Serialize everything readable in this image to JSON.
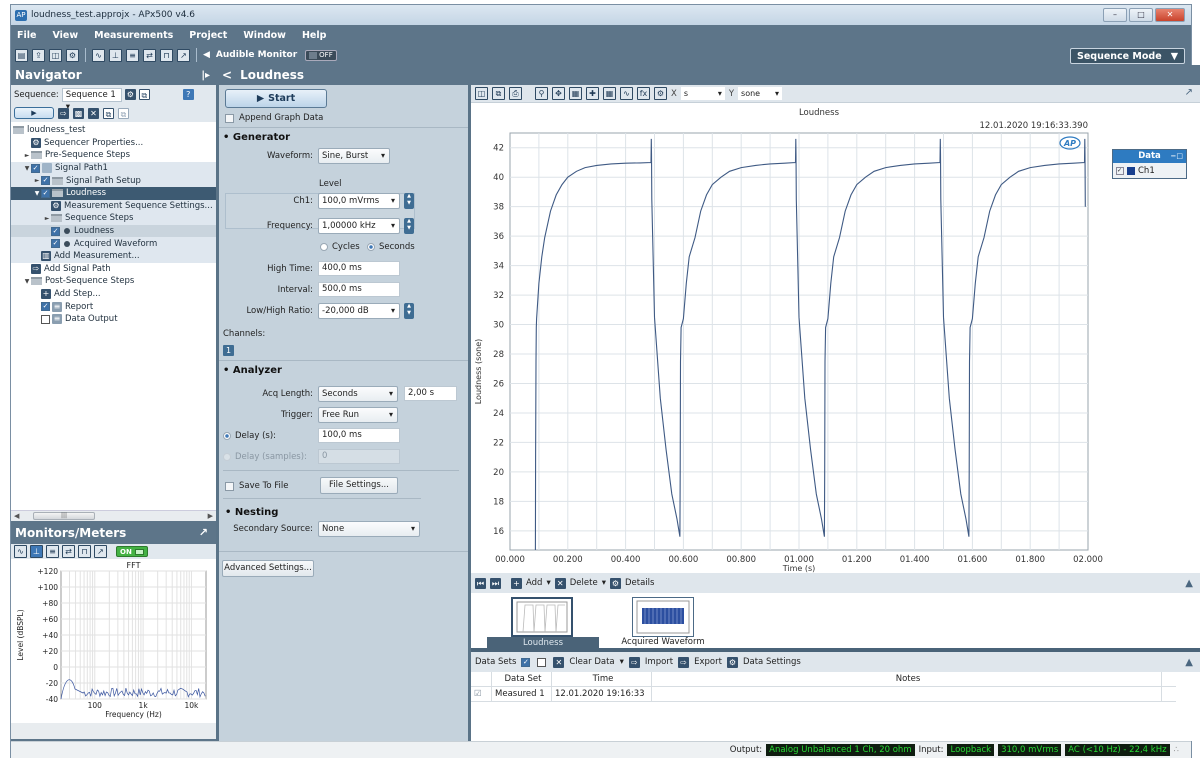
{
  "window": {
    "title": "loudness_test.approjx - APx500 v4.6",
    "buttons": [
      "minimize",
      "maximize",
      "close"
    ]
  },
  "menu": [
    "File",
    "View",
    "Measurements",
    "Project",
    "Window",
    "Help"
  ],
  "toolbar": {
    "icons": [
      "new-file-icon",
      "open-folder-icon",
      "save-icon",
      "settings-icon",
      "scope-icon",
      "fft-icon",
      "meter-icon",
      "level-icon",
      "pulse-icon",
      "add-monitor-icon"
    ],
    "audible_monitor_label": "Audible Monitor",
    "audible_monitor_state": "OFF",
    "mode_selector": "Sequence Mode"
  },
  "navigator": {
    "title": "Navigator",
    "sequence_label": "Sequence:",
    "sequence_value": "Sequence 1",
    "tree": [
      {
        "label": "loudness_test",
        "level": 0,
        "icon": "folder"
      },
      {
        "label": "Sequencer Properties...",
        "level": 1,
        "icon": "gear"
      },
      {
        "label": "Pre-Sequence Steps",
        "level": 1,
        "icon": "folder",
        "arrow": "►"
      },
      {
        "label": "Signal Path1",
        "level": 1,
        "icon": "signal-path",
        "arrow": "▼",
        "checked": true
      },
      {
        "label": "Signal Path Setup",
        "level": 2,
        "icon": "folder",
        "arrow": "►",
        "checked": true
      },
      {
        "label": "Loudness",
        "level": 2,
        "icon": "folder",
        "arrow": "▼",
        "checked": true,
        "selected": true
      },
      {
        "label": "Measurement Sequence Settings...",
        "level": 3,
        "icon": "gear"
      },
      {
        "label": "Sequence Steps",
        "level": 3,
        "icon": "folder",
        "arrow": "►"
      },
      {
        "label": "Loudness",
        "level": 3,
        "icon": "dot",
        "checked": true,
        "active": true
      },
      {
        "label": "Acquired Waveform",
        "level": 3,
        "icon": "dot",
        "checked": true
      },
      {
        "label": "Add Measurement...",
        "level": 2,
        "icon": "add-measurement"
      },
      {
        "label": "Add Signal Path",
        "level": 1,
        "icon": "add-signal-path"
      },
      {
        "label": "Post-Sequence Steps",
        "level": 1,
        "icon": "folder",
        "arrow": "▼"
      },
      {
        "label": "Add Step...",
        "level": 2,
        "icon": "plus"
      },
      {
        "label": "Report",
        "level": 2,
        "icon": "report",
        "checked": true
      },
      {
        "label": "Data Output",
        "level": 2,
        "icon": "data-output",
        "checked": false
      }
    ]
  },
  "monitors": {
    "title": "Monitors/Meters",
    "state": "ON",
    "fft": {
      "title": "FFT",
      "ylabel": "Level (dBSPL)",
      "xlabel": "Frequency (Hz)",
      "yticks": [
        "+120",
        "+100",
        "+80",
        "+60",
        "+40",
        "+20",
        "0",
        "-20",
        "-40"
      ],
      "xticks": [
        "100",
        "1k",
        "10k"
      ]
    }
  },
  "measurement": {
    "title": "Loudness",
    "start_label": "Start",
    "append_graph_data": "Append Graph Data",
    "generator": {
      "title": "Generator",
      "waveform_label": "Waveform:",
      "waveform": "Sine, Burst",
      "level_label": "Level",
      "ch1_label": "Ch1:",
      "ch1": "100,0 mVrms",
      "frequency_label": "Frequency:",
      "frequency": "1,00000 kHz",
      "cycles_label": "Cycles",
      "seconds_label": "Seconds",
      "high_time_label": "High Time:",
      "high_time": "400,0 ms",
      "interval_label": "Interval:",
      "interval": "500,0 ms",
      "ratio_label": "Low/High Ratio:",
      "ratio": "-20,000 dB",
      "channels_label": "Channels:",
      "channel_button": "1"
    },
    "analyzer": {
      "title": "Analyzer",
      "acq_length_label": "Acq Length:",
      "acq_length_mode": "Seconds",
      "acq_length": "2,00 s",
      "trigger_label": "Trigger:",
      "trigger": "Free Run",
      "delay_s_label": "Delay (s):",
      "delay_s": "100,0 ms",
      "delay_samples_label": "Delay (samples):",
      "delay_samples": "0",
      "save_to_file": "Save To File",
      "file_settings": "File Settings..."
    },
    "nesting": {
      "title": "Nesting",
      "secondary_source_label": "Secondary Source:",
      "secondary_source": "None"
    },
    "advanced_settings": "Advanced Settings..."
  },
  "graph": {
    "x_unit_label": "X",
    "x_unit": "s",
    "y_unit_label": "Y",
    "y_unit": "sone",
    "timestamp": "12.01.2020 19:16:33.390",
    "legend_title": "Data",
    "legend_items": [
      {
        "name": "Ch1",
        "color": "#173f8e",
        "checked": true
      }
    ]
  },
  "chart_data": {
    "type": "line",
    "title": "Loudness",
    "xlabel": "Time (s)",
    "ylabel": "Loudness (sone)",
    "xlim": [
      0,
      2.0
    ],
    "ylim": [
      14.7,
      43
    ],
    "xticks": [
      "00.000",
      "00.200",
      "00.400",
      "00.600",
      "00.800",
      "01.000",
      "01.200",
      "01.400",
      "01.600",
      "01.800",
      "02.000"
    ],
    "yticks": [
      16,
      18,
      20,
      22,
      24,
      26,
      28,
      30,
      32,
      34,
      36,
      38,
      40,
      42
    ],
    "grid": true,
    "legend": "right",
    "series": [
      {
        "name": "Ch1",
        "color": "#3f5a84",
        "x": [
          0.088,
          0.0885,
          0.09,
          0.091,
          0.092,
          0.1,
          0.11,
          0.12,
          0.14,
          0.16,
          0.18,
          0.2,
          0.23,
          0.26,
          0.3,
          0.35,
          0.4,
          0.45,
          0.488,
          0.489,
          0.4895,
          0.4905,
          0.5,
          0.52,
          0.54,
          0.56,
          0.578,
          0.588,
          0.589,
          0.59,
          0.592,
          0.6,
          0.61,
          0.62,
          0.64,
          0.66,
          0.68,
          0.7,
          0.73,
          0.76,
          0.8,
          0.85,
          0.9,
          0.95,
          0.988,
          0.989,
          0.9895,
          0.9905,
          1.0,
          1.02,
          1.04,
          1.06,
          1.078,
          1.088,
          1.089,
          1.09,
          1.092,
          1.1,
          1.11,
          1.12,
          1.14,
          1.16,
          1.18,
          1.2,
          1.23,
          1.26,
          1.3,
          1.35,
          1.4,
          1.45,
          1.488,
          1.489,
          1.4895,
          1.4905,
          1.5,
          1.52,
          1.54,
          1.56,
          1.578,
          1.588,
          1.589,
          1.59,
          1.592,
          1.6,
          1.61,
          1.62,
          1.64,
          1.66,
          1.68,
          1.7,
          1.73,
          1.76,
          1.8,
          1.85,
          1.9,
          1.95,
          1.988,
          1.989,
          1.9895,
          1.9905
        ],
        "y": [
          14.7,
          21.0,
          27.5,
          29.8,
          30.4,
          32.8,
          34.6,
          35.9,
          37.7,
          38.8,
          39.5,
          40.0,
          40.4,
          40.65,
          40.8,
          40.9,
          40.95,
          40.97,
          41.0,
          42.6,
          41.6,
          38.5,
          30.5,
          25.0,
          21.5,
          18.5,
          16.8,
          15.6,
          20.0,
          27.5,
          29.8,
          30.4,
          32.8,
          34.6,
          35.9,
          37.7,
          38.8,
          39.5,
          40.0,
          40.4,
          40.65,
          40.8,
          40.9,
          40.95,
          41.0,
          42.6,
          41.6,
          38.5,
          30.5,
          25.0,
          21.5,
          18.5,
          16.8,
          15.6,
          20.0,
          27.5,
          29.8,
          30.4,
          32.8,
          34.6,
          35.9,
          37.7,
          38.8,
          39.5,
          40.0,
          40.4,
          40.65,
          40.8,
          40.9,
          40.95,
          41.0,
          42.6,
          41.6,
          38.5,
          30.5,
          25.0,
          21.5,
          18.5,
          16.8,
          15.6,
          20.0,
          27.5,
          29.8,
          30.4,
          32.8,
          34.6,
          35.9,
          37.7,
          38.8,
          39.5,
          40.0,
          40.4,
          40.65,
          40.8,
          40.9,
          40.95,
          41.0,
          42.6,
          41.6,
          38.0
        ]
      }
    ]
  },
  "measurement_nav": {
    "add_label": "Add",
    "delete_label": "Delete",
    "details_label": "Details",
    "thumbnails": [
      {
        "label": "Loudness",
        "selected": true
      },
      {
        "label": "Acquired Waveform",
        "selected": false
      }
    ]
  },
  "data_sets": {
    "title": "Data Sets",
    "clear_data": "Clear Data",
    "import": "Import",
    "export": "Export",
    "data_settings": "Data Settings",
    "columns": [
      "Data Set",
      "Time",
      "Notes"
    ],
    "rows": [
      {
        "data_set": "Measured 1",
        "time": "12.01.2020 19:16:33",
        "notes": "",
        "checked": true
      }
    ]
  },
  "status": {
    "output_label": "Output:",
    "output": "Analog Unbalanced 1 Ch, 20 ohm",
    "input_label": "Input:",
    "input": "Loopback",
    "input_level": "310,0 mVrms",
    "input_bandwidth": "AC (<10 Hz) - 22,4 kHz"
  }
}
